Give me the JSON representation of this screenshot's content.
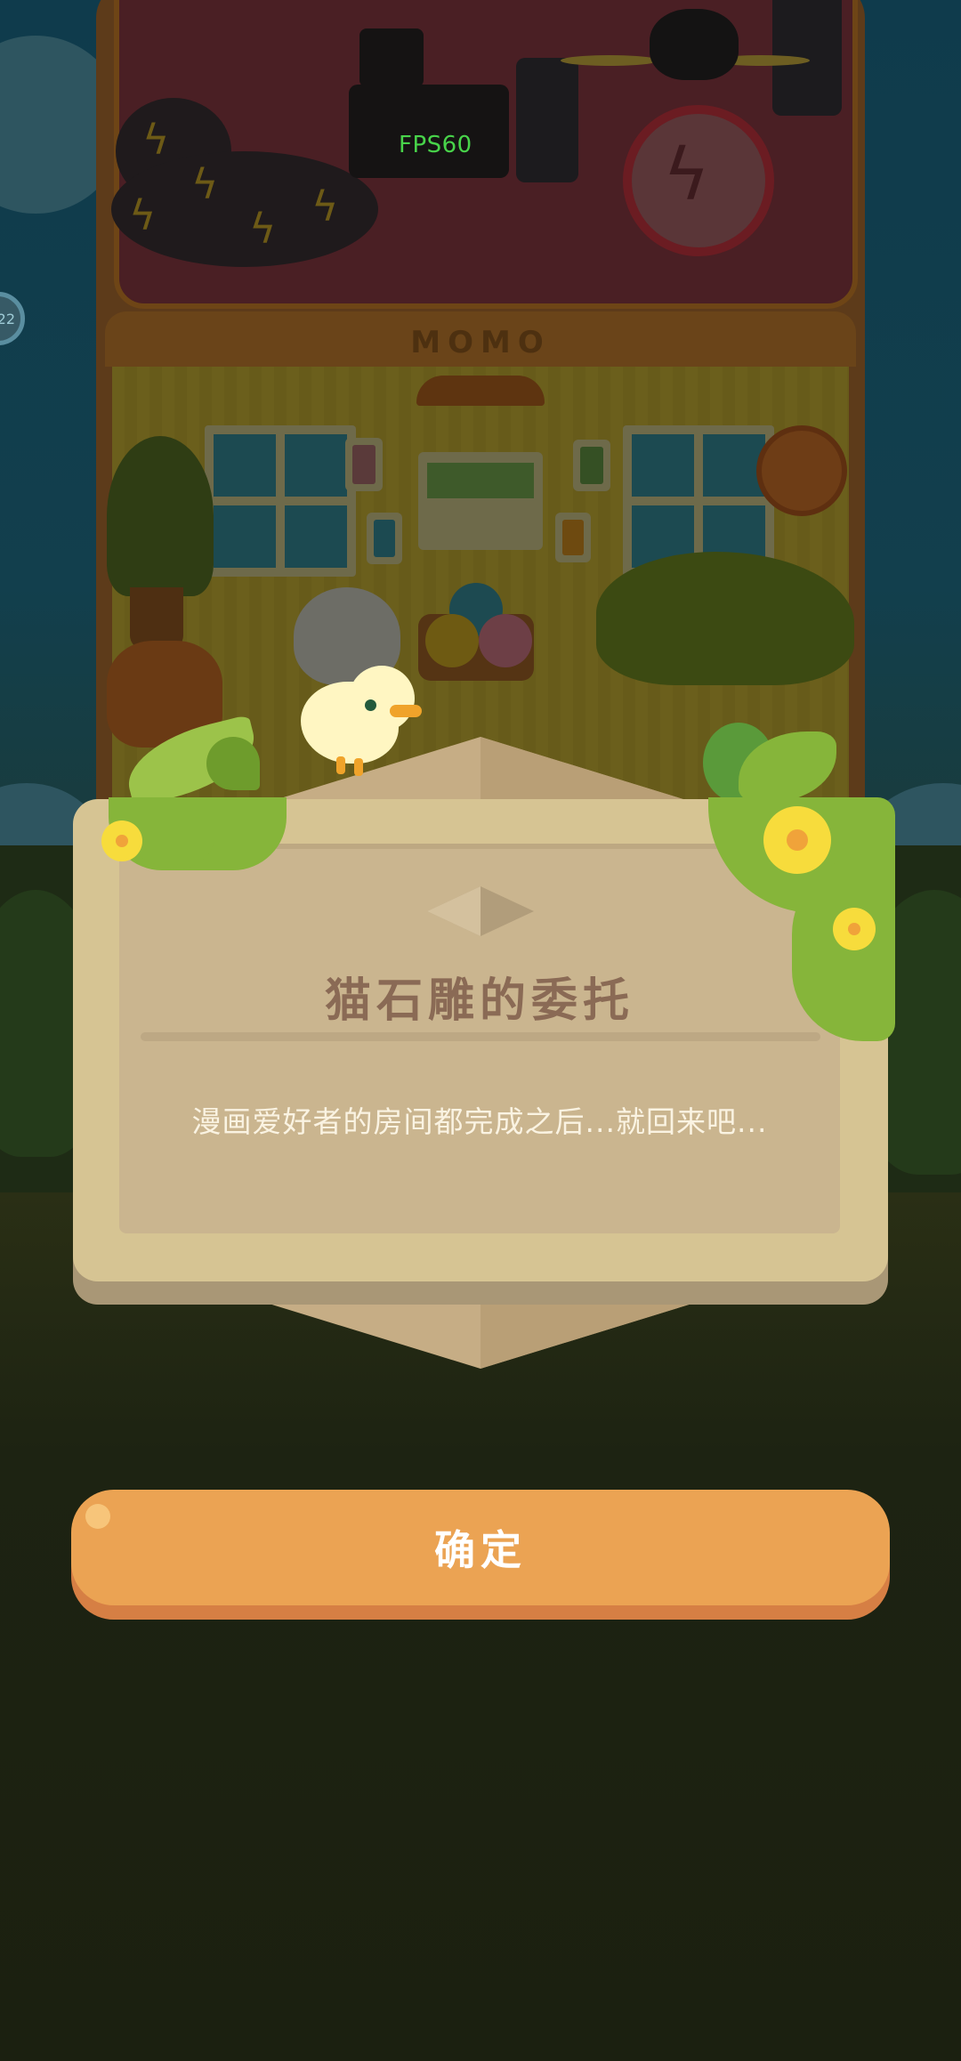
{
  "hud": {
    "fps_label": "FPS60",
    "side_badge": "22"
  },
  "scene": {
    "room_sign": "MOMO"
  },
  "dialog": {
    "title": "猫石雕的委托",
    "message": "漫画爱好者的房间都完成之后...就回来吧..."
  },
  "actions": {
    "confirm_label": "确定"
  },
  "colors": {
    "button_orange": "#eba353",
    "panel_beige": "#d6c493",
    "title_brown": "#8a6a55",
    "leaf_green": "#86b53a",
    "flower_yellow": "#f7dc3c",
    "fps_green": "#48d34a"
  }
}
